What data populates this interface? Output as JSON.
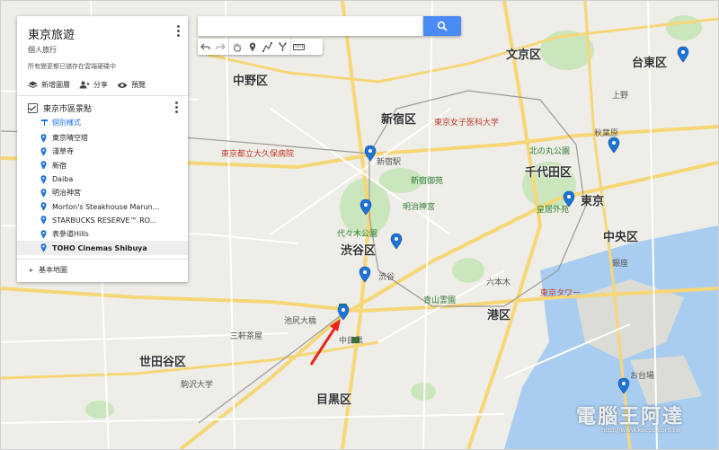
{
  "panel": {
    "title": "東京旅遊",
    "subtitle": "個人旅行",
    "saved_note": "所有變更都已儲存在雲端硬碟中",
    "actions": {
      "add_layer": "新增圖層",
      "share": "分享",
      "preview": "預覽"
    },
    "layer": {
      "name": "東京市區景點",
      "style_link": "個別樣式",
      "places": [
        {
          "label": "東京晴空塔"
        },
        {
          "label": "淺草寺"
        },
        {
          "label": "新宿"
        },
        {
          "label": "Daiba"
        },
        {
          "label": "明治神宮"
        },
        {
          "label": "Morton's Steakhouse Marun..."
        },
        {
          "label": "STARBUCKS RESERVE™ RO..."
        },
        {
          "label": "表參道Hills"
        },
        {
          "label": "TOHO Cinemas Shibuya"
        }
      ]
    },
    "basemap": "基本地圖"
  },
  "search": {
    "placeholder": "",
    "button_icon": "search-icon"
  },
  "toolbar": {
    "icons": [
      "undo-icon",
      "redo-icon",
      "hand-icon",
      "marker-icon",
      "draw-line-icon",
      "route-icon",
      "ruler-icon"
    ]
  },
  "map": {
    "wards": {
      "nakano": "中野区",
      "shinjuku": "新宿区",
      "bunkyo": "文京区",
      "taito": "台東区",
      "chiyoda": "千代田区",
      "tokyo": "東京",
      "chuo": "中央区",
      "shibuya": "渋谷区",
      "minato": "港区",
      "setagaya": "世田谷区",
      "meguro": "目黒区"
    },
    "places": {
      "toshima_hospital": "東京都立大久保病院",
      "meiji_shrine": "明治神宮",
      "yoyogi_park": "代々木公園",
      "gyoen": "新宿御苑",
      "imperial": "皇居外苑",
      "shinjuku_station": "新宿駅",
      "shibuya_station": "渋谷",
      "roppongi": "六本木",
      "tokyo_tower": "東京タワー",
      "aoyama_cemetery": "青山霊園",
      "ikejiri": "池尻大橋",
      "nakameguro": "中目黒",
      "sangenjaya": "三軒茶屋",
      "komazawa": "駒沢大学",
      "ueno": "上野",
      "akihabara": "秋葉原",
      "ginza": "銀座",
      "odaiba": "お台場",
      "tokyo_med": "東京女子医科大学",
      "kitano": "北の丸公園"
    },
    "watermark_text": "電腦王阿達",
    "watermark_url": "http://www.kocpc.com.tw"
  },
  "colors": {
    "accent": "#4a8af4",
    "pin": "#1e74d6",
    "arrow": "#e8261a",
    "park": "#c9e6bd",
    "water": "#a9cdf0"
  }
}
